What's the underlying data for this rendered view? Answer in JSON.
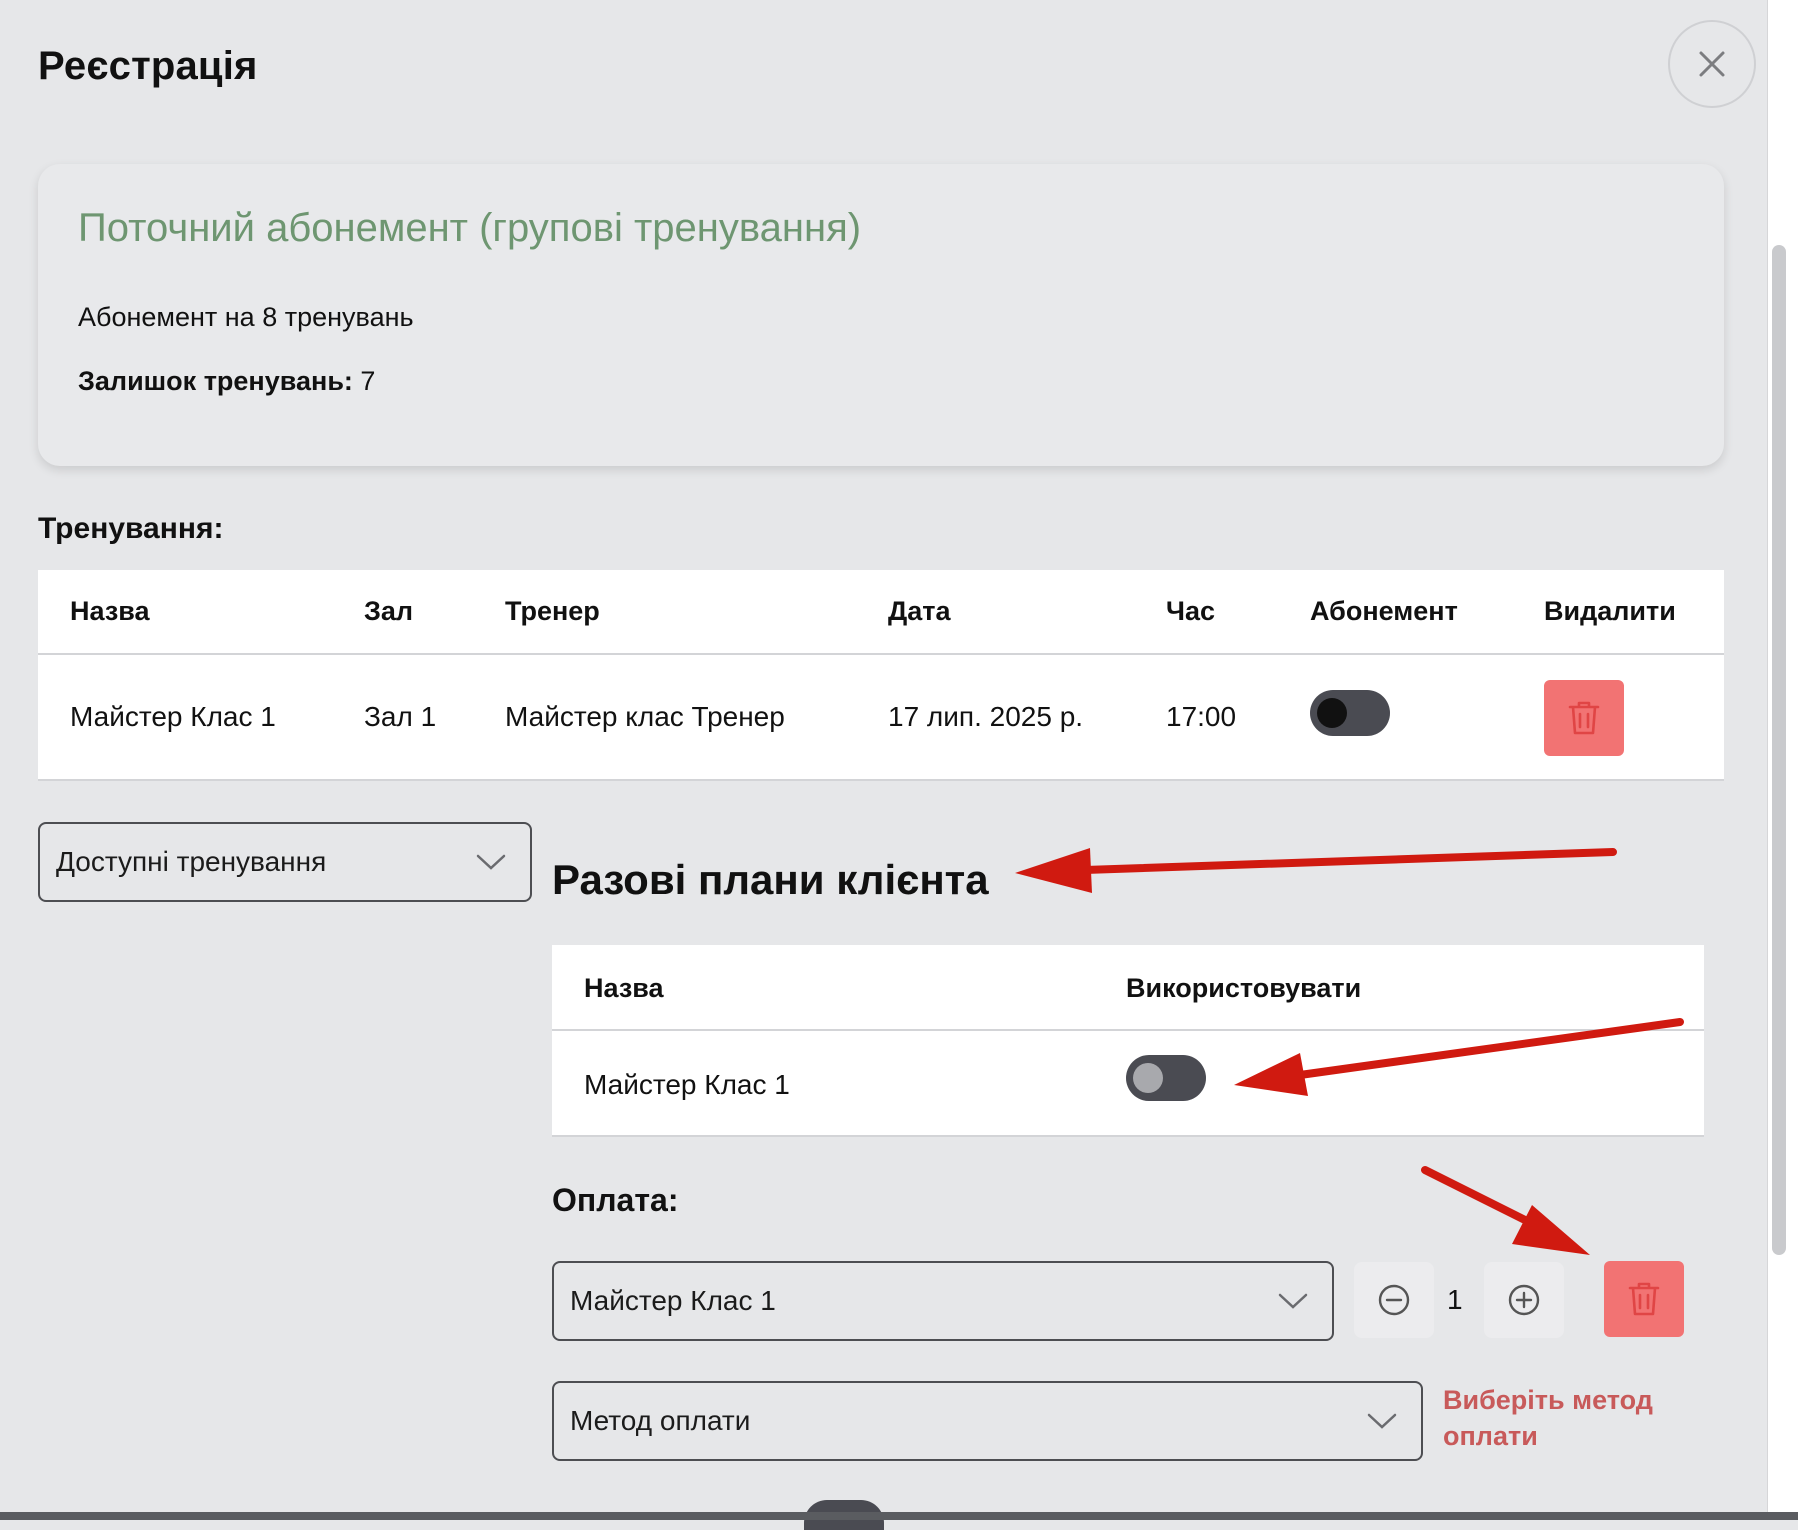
{
  "modal": {
    "title": "Реєстрація"
  },
  "subscription": {
    "title": "Поточний абонемент (групові тренування)",
    "name": "Абонемент на 8 тренувань",
    "remaining_label": "Залишок тренувань:",
    "remaining_value": "7"
  },
  "trainings": {
    "heading": "Тренування:",
    "columns": [
      "Назва",
      "Зал",
      "Тренер",
      "Дата",
      "Час",
      "Абонемент",
      "Видалити"
    ],
    "rows": [
      {
        "name": "Майстер Клас 1",
        "hall": "Зал 1",
        "trainer": "Майстер клас Тренер",
        "date": "17 лип. 2025 р.",
        "time": "17:00"
      }
    ]
  },
  "available_select": {
    "placeholder": "Доступні тренування"
  },
  "one_time_plans": {
    "heading": "Разові плани клієнта",
    "columns": [
      "Назва",
      "Використовувати"
    ],
    "rows": [
      {
        "name": "Майстер Клас 1"
      }
    ]
  },
  "payment": {
    "heading": "Оплата:",
    "item_select": "Майстер Клас 1",
    "quantity": "1",
    "method_placeholder": "Метод оплати",
    "error": "Виберіть метод оплати"
  },
  "colors": {
    "accent_green": "#6e9671",
    "danger": "#f27373",
    "error_text": "#c85a5a",
    "annotation_arrow": "#d01a10"
  }
}
